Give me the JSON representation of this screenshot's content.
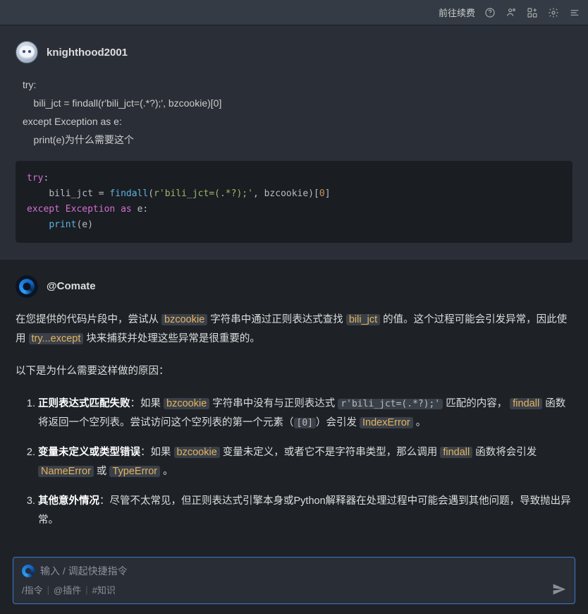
{
  "header": {
    "renew_link": "前往续费"
  },
  "user_message": {
    "username": "knighthood2001",
    "body_lines": [
      "try:",
      "    bili_jct = findall(r'bili_jct=(.*?);', bzcookie)[0]",
      "except Exception as e:",
      "    print(e)为什么需要这个"
    ],
    "code": {
      "l1_try": "try",
      "l2_indent": "    ",
      "l2_id": "bili_jct ",
      "l2_eq": "= ",
      "l2_fn": "findall",
      "l2_p1": "(",
      "l2_str": "r'bili_jct=(.*?);'",
      "l2_c": ", ",
      "l2_arg": "bzcookie",
      "l2_p2": ")[",
      "l2_num": "0",
      "l2_p3": "]",
      "l3_except": "except",
      "l3_sp": " ",
      "l3_exc": "Exception",
      "l3_as": " as ",
      "l3_e": "e",
      "l3_colon": ":",
      "l4_indent": "    ",
      "l4_print": "print",
      "l4_p1": "(",
      "l4_e": "e",
      "l4_p2": ")"
    }
  },
  "bot_message": {
    "botname": "@Comate",
    "p1_a": "在您提供的代码片段中，尝试从 ",
    "p1_chip1": "bzcookie",
    "p1_b": " 字符串中通过正则表达式查找 ",
    "p1_chip2": "bili_jct",
    "p1_c": " 的值。这个过程可能会引发异常，因此使用 ",
    "p1_chip3": "try...except",
    "p1_d": " 块来捕获并处理这些异常是很重要的。",
    "p2": "以下是为什么需要这样做的原因：",
    "li1_t": "正则表达式匹配失败",
    "li1_a": "：如果 ",
    "li1_c1": "bzcookie",
    "li1_b": " 字符串中没有与正则表达式 ",
    "li1_c2": "r'bili_jct=(.*?);'",
    "li1_c": " 匹配的内容， ",
    "li1_c3": "findall",
    "li1_d": " 函数将返回一个空列表。尝试访问这个空列表的第一个元素（",
    "li1_c4": "[0]",
    "li1_e": "）会引发 ",
    "li1_c5": "IndexError",
    "li1_f": " 。",
    "li2_t": "变量未定义或类型错误",
    "li2_a": "：如果 ",
    "li2_c1": "bzcookie",
    "li2_b": " 变量未定义，或者它不是字符串类型，那么调用 ",
    "li2_c2": "findall",
    "li2_c": " 函数将会引发 ",
    "li2_c3": "NameError",
    "li2_d": " 或 ",
    "li2_c4": "TypeError",
    "li2_e": " 。",
    "li3_t": "其他意外情况",
    "li3_a": "：尽管不太常见，但正则表达式引擎本身或Python解释器在处理过程中可能会遇到其他问题，导致抛出异常。"
  },
  "composer": {
    "placeholder": "输入 / 调起快捷指令",
    "hint_cmd": "/指令",
    "hint_plugin": "@插件",
    "hint_know": "#知识",
    "sep": "|"
  }
}
